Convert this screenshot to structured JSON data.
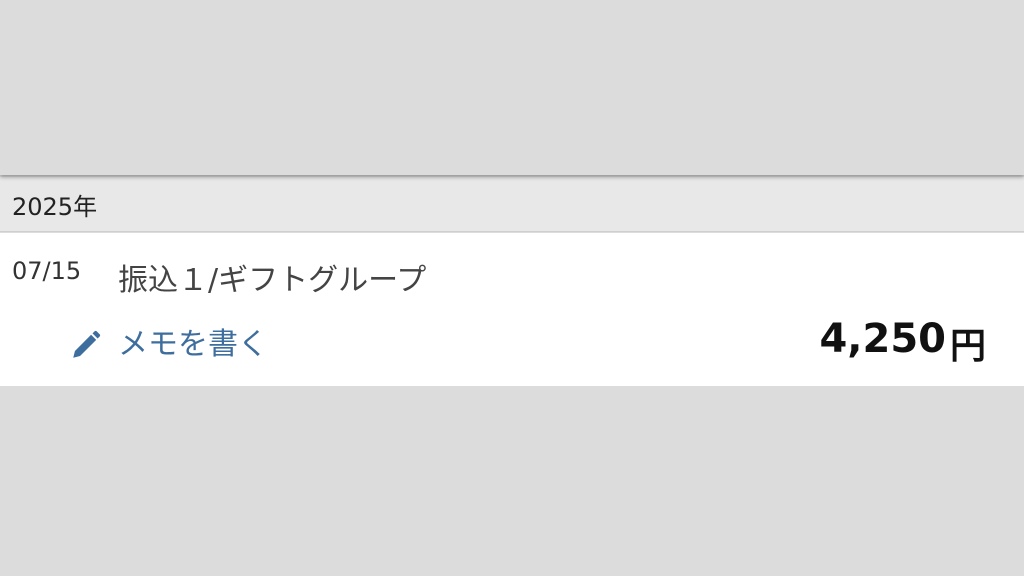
{
  "section": {
    "year_label": "2025年"
  },
  "transaction": {
    "date": "07/15",
    "description": "振込１/ギフトグループ",
    "memo_label": "メモを書く",
    "memo_icon": "pencil-icon",
    "amount": "4,250",
    "currency_unit": "円"
  },
  "colors": {
    "link": "#3e6e9e",
    "header_bg": "#e8e8e8",
    "row_bg": "#ffffff",
    "page_bg": "#dcdcdc"
  }
}
